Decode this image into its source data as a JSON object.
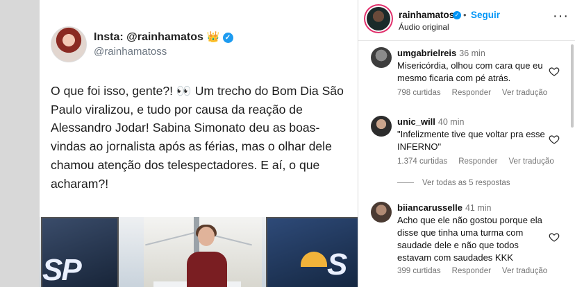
{
  "tweet": {
    "name": "Insta: @rainhamatos",
    "crown": "👑",
    "handle": "@rainhamatoss",
    "text": "O que foi isso, gente?! 👀 Um trecho do Bom Dia São Paulo viralizou, e tudo por causa da reação de Alessandro Jodar! Sabina Simonato deu as boas-vindas ao jornalista após as férias, mas o olhar dele chamou atenção dos telespectadores. E aí, o que acharam?!",
    "tv_logo": "SP"
  },
  "post_header": {
    "username": "rainhamatos",
    "separator": "•",
    "follow": "Seguir",
    "audio": "Áudio original",
    "more": "···"
  },
  "comments": [
    {
      "user": "umgabrielreis",
      "time": "36 min",
      "text": "Misericórdia, olhou com cara que eu mesmo ficaria com pé atrás.",
      "likes": "798 curtidas",
      "reply": "Responder",
      "translate": "Ver tradução"
    },
    {
      "user": "unic_will",
      "time": "40 min",
      "text": "\"Infelizmente tive que voltar pra esse INFERNO\"",
      "likes": "1.374 curtidas",
      "reply": "Responder",
      "translate": "Ver tradução"
    },
    {
      "user": "biiancarusselle",
      "time": "41 min",
      "text": "Acho que ele não gostou porque ela disse que tinha uma turma com saudade dele e não que todos estavam com saudades KKK",
      "likes": "399 curtidas",
      "reply": "Responder",
      "translate": "Ver tradução"
    }
  ],
  "view_replies": "Ver todas as 5 respostas",
  "colors": {
    "accent": "#0095f6",
    "verified_twitter": "#1d9bf0",
    "story_ring": "#e1306c"
  },
  "icons": [
    "verified-icon",
    "crown-icon",
    "heart-icon",
    "more-icon"
  ]
}
